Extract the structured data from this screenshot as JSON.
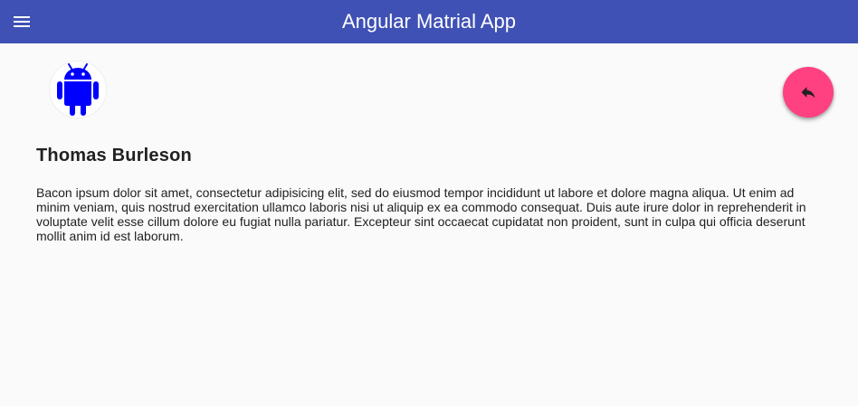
{
  "toolbar": {
    "title": "Angular Matrial App",
    "menu_icon": "menu-icon",
    "background_color": "#3f51b5"
  },
  "user": {
    "avatar_icon": "android-icon",
    "avatar_color": "#0000ff",
    "name": "Thomas Burleson",
    "bio": "Bacon ipsum dolor sit amet, consectetur adipisicing elit, sed do eiusmod tempor incididunt ut labore et dolore magna aliqua. Ut enim ad minim veniam, quis nostrud exercitation ullamco laboris nisi ut aliquip ex ea commodo consequat. Duis aute irure dolor in reprehenderit in voluptate velit esse cillum dolore eu fugiat nulla pariatur. Excepteur sint occaecat cupidatat non proident, sunt in culpa qui officia deserunt mollit anim id est laborum."
  },
  "fab": {
    "icon": "reply-icon",
    "color": "#ff4081"
  }
}
